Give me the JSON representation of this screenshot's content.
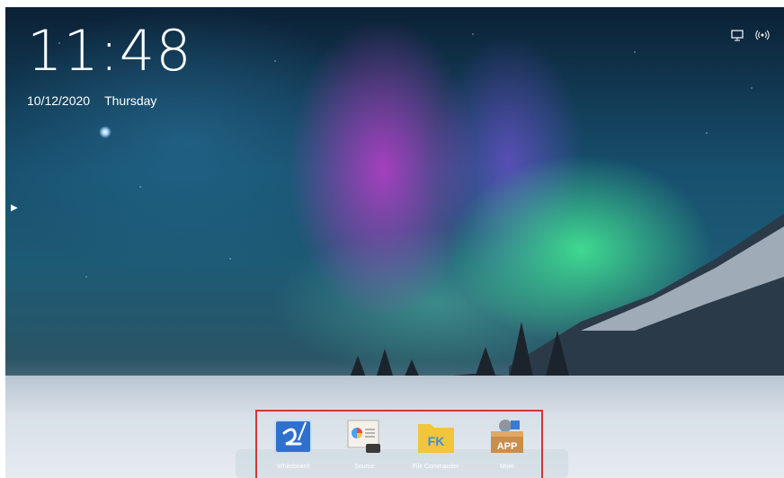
{
  "clock": {
    "time": "11:48",
    "date": "10/12/2020",
    "weekday": "Thursday"
  },
  "status": {
    "icons": [
      "monitor-icon",
      "wireless-icon"
    ]
  },
  "dock": {
    "apps": [
      {
        "label": "Whiteboard",
        "icon": "whiteboard-icon",
        "color": "#3a7ad8"
      },
      {
        "label": "Source",
        "icon": "source-icon",
        "color": "#f4f1ea"
      },
      {
        "label": "File Commander",
        "icon": "file-commander-icon",
        "color": "#f2c53d"
      },
      {
        "label": "More",
        "icon": "app-box-icon",
        "color": "#c98d4c"
      }
    ]
  }
}
